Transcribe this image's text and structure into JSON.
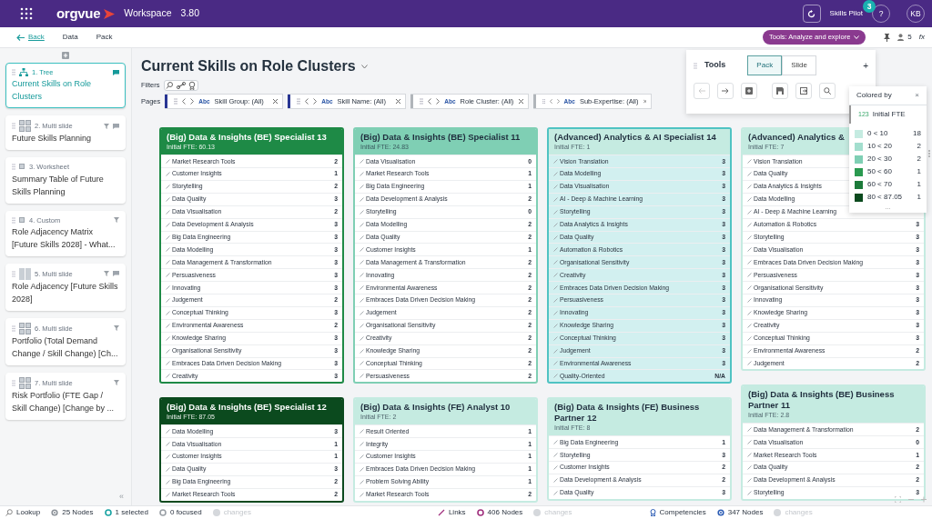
{
  "app": {
    "logo": "orgvue",
    "workspace": "Workspace",
    "version": "3.80",
    "user_menu": "Skills Pilot",
    "notifications": "3",
    "help": "?",
    "avatar": "KB"
  },
  "toolbar": {
    "back": "Back",
    "tabs": [
      "Data",
      "Pack"
    ],
    "mode": "Tools: Analyze and explore",
    "viewers": "5",
    "formula": "fx"
  },
  "sidebar": {
    "items": [
      {
        "kind": "tree",
        "label": "1. Tree",
        "title": "Current Skills on Role Clusters",
        "selected": true,
        "filtered": false,
        "commented": true
      },
      {
        "kind": "multi",
        "label": "2. Multi slide",
        "title": "Future Skills Planning",
        "selected": false,
        "filtered": true,
        "commented": true
      },
      {
        "kind": "single",
        "label": "3. Worksheet",
        "title": "Summary Table of Future Skills Planning",
        "selected": false,
        "filtered": false,
        "commented": false
      },
      {
        "kind": "single",
        "label": "4. Custom",
        "title": "Role Adjacency Matrix [Future Skills 2028] - What...",
        "selected": false,
        "filtered": true,
        "commented": false
      },
      {
        "kind": "pair",
        "label": "5. Multi slide",
        "title": "Role Adjacency [Future Skills 2028]",
        "selected": false,
        "filtered": true,
        "commented": true
      },
      {
        "kind": "multi",
        "label": "6. Multi slide",
        "title": "Portfolio (Total Demand Change / Skill Change) [Ch...",
        "selected": false,
        "filtered": true,
        "commented": false
      },
      {
        "kind": "multi",
        "label": "7. Multi slide",
        "title": "Risk Portfolio (FTE Gap / Skill Change) [Change by ...",
        "selected": false,
        "filtered": true,
        "commented": false
      }
    ],
    "collapse": "«"
  },
  "page": {
    "title": "Current Skills on Role Clusters",
    "filters_label": "Filters",
    "pages_label": "Pages",
    "chips": [
      {
        "type": "Abc",
        "text": "Skill Group: (All)",
        "color": "#283593"
      },
      {
        "type": "Abc",
        "text": "Skill Name: (All)",
        "color": "#283593"
      },
      {
        "type": "Abc",
        "text": "Role Cluster: (All)",
        "color": "#b0b5ba"
      },
      {
        "type": "Abc",
        "text": "Sub-Expertise: (All)",
        "color": "#b0b5ba"
      }
    ]
  },
  "columns": [
    {
      "cards": [
        {
          "title": "(Big) Data & Insights (BE) Specialist 13",
          "fte": "Initial FTE: 60.13",
          "color": "#1e8a46",
          "selected": false,
          "rows": [
            {
              "name": "Market Research Tools",
              "value": "2"
            },
            {
              "name": "Customer Insights",
              "value": "1"
            },
            {
              "name": "Storytelling",
              "value": "2"
            },
            {
              "name": "Data Quality",
              "value": "3"
            },
            {
              "name": "Data Visualisation",
              "value": "2"
            },
            {
              "name": "Data Development & Analysis",
              "value": "3"
            },
            {
              "name": "Big Data Engineering",
              "value": "3"
            },
            {
              "name": "Data Modelling",
              "value": "3"
            },
            {
              "name": "Data Management & Transformation",
              "value": "3"
            },
            {
              "name": "Persuasiveness",
              "value": "3"
            },
            {
              "name": "Innovating",
              "value": "3"
            },
            {
              "name": "Judgement",
              "value": "2"
            },
            {
              "name": "Conceptual Thinking",
              "value": "3"
            },
            {
              "name": "Environmental Awareness",
              "value": "2"
            },
            {
              "name": "Knowledge Sharing",
              "value": "3"
            },
            {
              "name": "Organisational Sensitivity",
              "value": "3"
            },
            {
              "name": "Embraces Data Driven Decision Making",
              "value": "3"
            },
            {
              "name": "Creativity",
              "value": "3"
            }
          ]
        },
        {
          "title": "(Big) Data & Insights (BE) Specialist 12",
          "fte": "Initial FTE: 87.05",
          "color": "#0b4a1e",
          "selected": false,
          "rows": [
            {
              "name": "Data Modelling",
              "value": "3"
            },
            {
              "name": "Data Visualisation",
              "value": "1"
            },
            {
              "name": "Customer Insights",
              "value": "1"
            },
            {
              "name": "Data Quality",
              "value": "3"
            },
            {
              "name": "Big Data Engineering",
              "value": "2"
            },
            {
              "name": "Market Research Tools",
              "value": "2"
            }
          ]
        }
      ]
    },
    {
      "cards": [
        {
          "title": "(Big) Data & Insights (BE) Specialist 11",
          "fte": "Initial FTE: 24.83",
          "color": "#7fcfb4",
          "selected": false,
          "rows": [
            {
              "name": "Data Visualisation",
              "value": "0"
            },
            {
              "name": "Market Research Tools",
              "value": "1"
            },
            {
              "name": "Big Data Engineering",
              "value": "1"
            },
            {
              "name": "Data Development & Analysis",
              "value": "2"
            },
            {
              "name": "Storytelling",
              "value": "0"
            },
            {
              "name": "Data Modelling",
              "value": "2"
            },
            {
              "name": "Data Quality",
              "value": "2"
            },
            {
              "name": "Customer Insights",
              "value": "1"
            },
            {
              "name": "Data Management & Transformation",
              "value": "2"
            },
            {
              "name": "Innovating",
              "value": "2"
            },
            {
              "name": "Environmental Awareness",
              "value": "2"
            },
            {
              "name": "Embraces Data Driven Decision Making",
              "value": "2"
            },
            {
              "name": "Judgement",
              "value": "2"
            },
            {
              "name": "Organisational Sensitivity",
              "value": "2"
            },
            {
              "name": "Creativity",
              "value": "2"
            },
            {
              "name": "Knowledge Sharing",
              "value": "2"
            },
            {
              "name": "Conceptual Thinking",
              "value": "2"
            },
            {
              "name": "Persuasiveness",
              "value": "2"
            }
          ]
        },
        {
          "title": "(Big) Data & Insights (FE) Analyst 10",
          "fte": "Initial FTE: 2",
          "color": "#c5ebe1",
          "selected": false,
          "rows": [
            {
              "name": "Result Oriented",
              "value": "1"
            },
            {
              "name": "Integrity",
              "value": "1"
            },
            {
              "name": "Customer Insights",
              "value": "1"
            },
            {
              "name": "Embraces Data Driven Decision Making",
              "value": "1"
            },
            {
              "name": "Problem Solving Ability",
              "value": "1"
            },
            {
              "name": "Market Research Tools",
              "value": "2"
            }
          ]
        }
      ]
    },
    {
      "cards": [
        {
          "title": "(Advanced) Analytics & AI Specialist 14",
          "fte": "Initial FTE: 1",
          "color": "#c5ebe1",
          "selected": true,
          "rows": [
            {
              "name": "Vision Translation",
              "value": "3"
            },
            {
              "name": "Data Modelling",
              "value": "3"
            },
            {
              "name": "Data Visualisation",
              "value": "3"
            },
            {
              "name": "AI - Deep & Machine Learning",
              "value": "3"
            },
            {
              "name": "Storytelling",
              "value": "3"
            },
            {
              "name": "Data Analytics & Insights",
              "value": "3"
            },
            {
              "name": "Data Quality",
              "value": "3"
            },
            {
              "name": "Automation & Robotics",
              "value": "3"
            },
            {
              "name": "Organisational Sensitivity",
              "value": "3"
            },
            {
              "name": "Creativity",
              "value": "3"
            },
            {
              "name": "Embraces Data Driven Decision Making",
              "value": "3"
            },
            {
              "name": "Persuasiveness",
              "value": "3"
            },
            {
              "name": "Innovating",
              "value": "3"
            },
            {
              "name": "Knowledge Sharing",
              "value": "3"
            },
            {
              "name": "Conceptual Thinking",
              "value": "3"
            },
            {
              "name": "Judgement",
              "value": "3"
            },
            {
              "name": "Environmental Awareness",
              "value": "3"
            },
            {
              "name": "Quality-Oriented",
              "value": "N/A"
            }
          ]
        },
        {
          "title": "(Big) Data & Insights (FE) Business Partner 12",
          "fte": "Initial FTE: 8",
          "color": "#c5ebe1",
          "selected": false,
          "rows": [
            {
              "name": "Big Data Engineering",
              "value": "1"
            },
            {
              "name": "Storytelling",
              "value": "3"
            },
            {
              "name": "Customer Insights",
              "value": "2"
            },
            {
              "name": "Data Development & Analysis",
              "value": "2"
            },
            {
              "name": "Data Quality",
              "value": "3"
            }
          ]
        }
      ]
    },
    {
      "cards": [
        {
          "title": "(Advanced) Analytics &",
          "fte": "Initial FTE: 7",
          "color": "#c5ebe1",
          "selected": false,
          "rows": [
            {
              "name": "Vision Translation"
            },
            {
              "name": "Data Quality"
            },
            {
              "name": "Data Analytics & Insights"
            },
            {
              "name": "Data Modelling"
            },
            {
              "name": "AI - Deep & Machine Learning"
            },
            {
              "name": "Automation & Robotics",
              "value": "3"
            },
            {
              "name": "Storytelling",
              "value": "3"
            },
            {
              "name": "Data Visualisation",
              "value": "3"
            },
            {
              "name": "Embraces Data Driven Decision Making",
              "value": "3"
            },
            {
              "name": "Persuasiveness",
              "value": "3"
            },
            {
              "name": "Organisational Sensitivity",
              "value": "3"
            },
            {
              "name": "Innovating",
              "value": "3"
            },
            {
              "name": "Knowledge Sharing",
              "value": "3"
            },
            {
              "name": "Creativity",
              "value": "3"
            },
            {
              "name": "Conceptual Thinking",
              "value": "3"
            },
            {
              "name": "Environmental Awareness",
              "value": "2"
            },
            {
              "name": "Judgement",
              "value": "2"
            }
          ]
        },
        {
          "title": "(Big) Data & Insights (BE) Business Partner 11",
          "fte": "Initial FTE: 2.8",
          "color": "#c5ebe1",
          "selected": false,
          "rows": [
            {
              "name": "Data Management & Transformation",
              "value": "2"
            },
            {
              "name": "Data Visualisation",
              "value": "0"
            },
            {
              "name": "Market Research Tools",
              "value": "1"
            },
            {
              "name": "Data Quality",
              "value": "2"
            },
            {
              "name": "Data Development & Analysis",
              "value": "2"
            },
            {
              "name": "Storytelling",
              "value": "3"
            }
          ]
        }
      ]
    }
  ],
  "tools": {
    "title": "Tools",
    "tabs": [
      {
        "label": "Pack",
        "selected": true
      },
      {
        "label": "Slide",
        "selected": false
      }
    ],
    "add": "+"
  },
  "legend": {
    "title": "Colored by",
    "close": "×",
    "type": "123",
    "field": "Initial FTE",
    "more": "...",
    "items": [
      {
        "range": "0 < 10",
        "count": "18",
        "color": "#c5ebe1"
      },
      {
        "range": "10 < 20",
        "count": "2",
        "color": "#a3dece"
      },
      {
        "range": "20 < 30",
        "count": "2",
        "color": "#7fcfb4"
      },
      {
        "range": "50 < 60",
        "count": "1",
        "color": "#2a9a50"
      },
      {
        "range": "60 < 70",
        "count": "1",
        "color": "#1c7a3a"
      },
      {
        "range": "80 < 87.05",
        "count": "1",
        "color": "#0b4a1e"
      }
    ]
  },
  "status_bar": [
    {
      "items": [
        {
          "kind": "search",
          "text": "Lookup"
        },
        {
          "kind": "node",
          "text": "25 Nodes",
          "color": "#8a9097"
        },
        {
          "kind": "ring",
          "text": "1 selected",
          "color": "#1aa3a3"
        },
        {
          "kind": "ring",
          "text": "0 focused",
          "color": "#9aa0a6"
        },
        {
          "kind": "changes",
          "text": "changes",
          "disabled": true
        }
      ]
    },
    {
      "items": [
        {
          "kind": "link",
          "text": "Links"
        },
        {
          "kind": "ring",
          "text": "406 Nodes",
          "color": "#a0307e"
        },
        {
          "kind": "changes",
          "text": "changes",
          "disabled": true
        }
      ]
    },
    {
      "items": [
        {
          "kind": "badge",
          "text": "Competencies"
        },
        {
          "kind": "node",
          "text": "347 Nodes",
          "color": "#2d5db5"
        },
        {
          "kind": "changes",
          "text": "changes",
          "disabled": true
        }
      ]
    }
  ]
}
